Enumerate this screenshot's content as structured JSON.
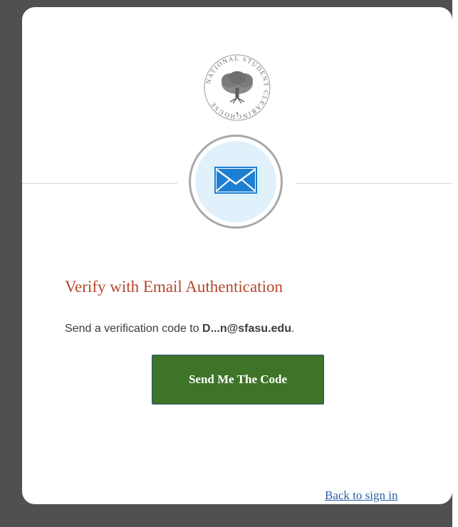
{
  "logo": {
    "icon": "national-student-clearinghouse-seal-icon",
    "seal_text": "NATIONAL STUDENT CLEARINGHOUSE"
  },
  "auth": {
    "icon": "envelope-icon",
    "title": "Verify with Email Authentication",
    "description_prefix": "Send a verification code to ",
    "masked_email": "D...n@sfasu.edu",
    "description_suffix": ".",
    "send_button_label": "Send Me The Code",
    "back_link_label": "Back to sign in"
  },
  "colors": {
    "title": "#b3472c",
    "button": "#3e7428",
    "link": "#2a5fa8",
    "envelope": "#1d7fd1",
    "icon_bg": "#e1f1fc"
  }
}
